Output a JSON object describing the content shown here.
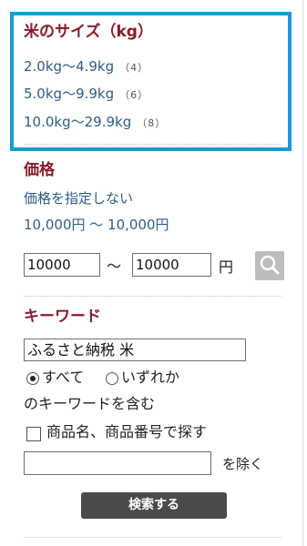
{
  "rice_size": {
    "title": "米のサイズ（kg）",
    "options": [
      {
        "label": "2.0kg〜4.9kg",
        "count": "（4）"
      },
      {
        "label": "5.0kg〜9.9kg",
        "count": "（6）"
      },
      {
        "label": "10.0kg〜29.9kg",
        "count": "（8）"
      }
    ]
  },
  "price": {
    "title": "価格",
    "unspecified_label": "価格を指定しない",
    "range_text": "10,000円 〜 10,000円",
    "min_value": "10000",
    "max_value": "10000",
    "range_separator": "〜",
    "unit": "円"
  },
  "keyword": {
    "title": "キーワード",
    "value": "ふるさと納税 米",
    "radio_all_label": "すべて",
    "radio_any_label": "いずれか",
    "radio_selected": "all",
    "contains_text": "のキーワードを含む",
    "checkbox_label": "商品名、商品番号で探す",
    "checkbox_checked": false,
    "exclude_value": "",
    "exclude_label": "を除く"
  },
  "search_button_label": "検索する",
  "colors": {
    "highlight_border": "#189ad6",
    "section_title": "#8b1c2a",
    "link": "#2e5d87",
    "search_icon_bg": "#bdbdbd",
    "submit_bg": "#4a4a4a"
  },
  "icons": {
    "price_search": "magnifier-icon"
  }
}
